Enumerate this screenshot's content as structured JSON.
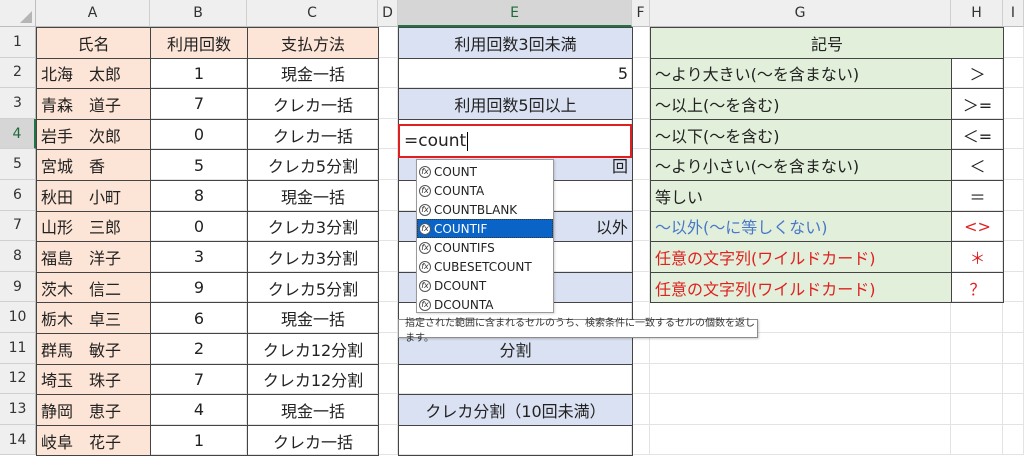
{
  "columns": [
    "A",
    "B",
    "C",
    "D",
    "E",
    "F",
    "G",
    "H",
    "I"
  ],
  "rows": [
    "1",
    "2",
    "3",
    "4",
    "5",
    "6",
    "7",
    "8",
    "9",
    "10",
    "11",
    "12",
    "13",
    "14"
  ],
  "table": {
    "header": [
      "氏名",
      "利用回数",
      "支払方法"
    ],
    "rows": [
      [
        "北海　太郎",
        "1",
        "現金一括"
      ],
      [
        "青森　道子",
        "7",
        "クレカ一括"
      ],
      [
        "岩手　次郎",
        "0",
        "クレカ一括"
      ],
      [
        "宮城　香",
        "5",
        "クレカ5分割"
      ],
      [
        "秋田　小町",
        "8",
        "現金一括"
      ],
      [
        "山形　三郎",
        "0",
        "クレカ3分割"
      ],
      [
        "福島　洋子",
        "3",
        "クレカ3分割"
      ],
      [
        "茨木　信二",
        "9",
        "クレカ5分割"
      ],
      [
        "栃木　卓三",
        "6",
        "現金一括"
      ],
      [
        "群馬　敏子",
        "2",
        "クレカ12分割"
      ],
      [
        "埼玉　珠子",
        "7",
        "クレカ12分割"
      ],
      [
        "静岡　恵子",
        "4",
        "現金一括"
      ],
      [
        "岐阜　花子",
        "1",
        "クレカ一括"
      ]
    ]
  },
  "column_e": {
    "r1": "利用回数3回未満",
    "r2": "5",
    "r3": "利用回数5回以上",
    "r5_tail": "回",
    "r7_tail": "以外",
    "r11": "分割",
    "r13": "クレカ分割（10回未満）"
  },
  "editing": {
    "cell": "E4",
    "formula": "=count"
  },
  "autocomplete": {
    "items": [
      "COUNT",
      "COUNTA",
      "COUNTBLANK",
      "COUNTIF",
      "COUNTIFS",
      "CUBESETCOUNT",
      "DCOUNT",
      "DCOUNTA"
    ],
    "selected_index": 3,
    "tooltip": "指定された範囲に含まれるセルのうち、検索条件に一致するセルの個数を返します。"
  },
  "legend": {
    "title": "記号",
    "rows": [
      {
        "text": "〜より大きい(〜を含まない)",
        "symbol": "＞",
        "color": "#222222"
      },
      {
        "text": "〜以上(〜を含む)",
        "symbol": "＞=",
        "color": "#222222"
      },
      {
        "text": "〜以下(〜を含む)",
        "symbol": "＜=",
        "color": "#222222"
      },
      {
        "text": "〜より小さい(〜を含まない)",
        "symbol": "＜",
        "color": "#222222"
      },
      {
        "text": "等しい",
        "symbol": "＝",
        "color": "#222222"
      },
      {
        "text": "〜以外(〜に等しくない)",
        "symbol": "<>",
        "color": "#4a78c9",
        "symbol_color": "#e02020"
      },
      {
        "text": "任意の文字列(ワイルドカード)",
        "symbol": "＊",
        "color": "#e02020"
      },
      {
        "text": "任意の文字列(ワイルドカード)",
        "symbol": "？",
        "color": "#e02020"
      }
    ]
  }
}
